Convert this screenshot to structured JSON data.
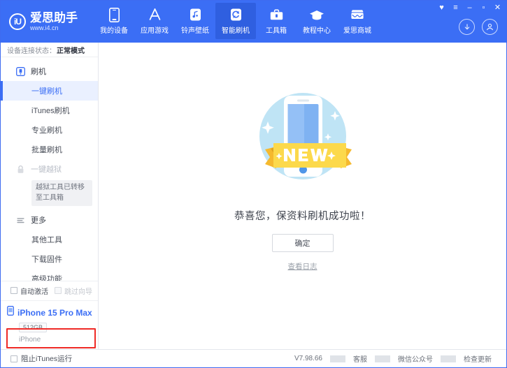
{
  "header": {
    "logo": {
      "badge": "iU",
      "title": "爱思助手",
      "url": "www.i4.cn"
    },
    "nav": [
      {
        "label": "我的设备",
        "icon": "phone-icon",
        "active": false
      },
      {
        "label": "应用游戏",
        "icon": "appstore-icon",
        "active": false
      },
      {
        "label": "铃声壁纸",
        "icon": "music-icon",
        "active": false
      },
      {
        "label": "智能刷机",
        "icon": "refresh-icon",
        "active": true
      },
      {
        "label": "工具箱",
        "icon": "toolbox-icon",
        "active": false
      },
      {
        "label": "教程中心",
        "icon": "graduation-cap-icon",
        "active": false
      },
      {
        "label": "爱思商城",
        "icon": "shop-icon",
        "active": false
      }
    ],
    "window_controls": [
      {
        "name": "skin-icon",
        "glyph": "♥"
      },
      {
        "name": "menu-icon",
        "glyph": "≡"
      },
      {
        "name": "minimize-icon",
        "glyph": "–"
      },
      {
        "name": "maximize-icon",
        "glyph": "▫"
      },
      {
        "name": "close-icon",
        "glyph": "✕"
      }
    ],
    "account_icons": [
      {
        "name": "download-icon"
      },
      {
        "name": "user-account-icon"
      }
    ]
  },
  "sidebar": {
    "connection_label": "设备连接状态：",
    "connection_value": "正常模式",
    "groups": [
      {
        "label": "刷机",
        "icon": "flash-icon",
        "disabled": false
      },
      {
        "label": "一键越狱",
        "icon": "lock-icon",
        "disabled": true
      },
      {
        "label": "更多",
        "icon": "list-icon",
        "disabled": false
      }
    ],
    "items_flash": [
      {
        "label": "一键刷机",
        "active": true
      },
      {
        "label": "iTunes刷机",
        "active": false
      },
      {
        "label": "专业刷机",
        "active": false
      },
      {
        "label": "批量刷机",
        "active": false
      }
    ],
    "jailbreak_note": "越狱工具已转移至工具箱",
    "items_more": [
      {
        "label": "其他工具",
        "active": false
      },
      {
        "label": "下载固件",
        "active": false
      },
      {
        "label": "高级功能",
        "active": false
      }
    ],
    "options": [
      {
        "label": "自动激活",
        "checked": false,
        "disabled": false
      },
      {
        "label": "跳过向导",
        "checked": false,
        "disabled": true
      }
    ],
    "device": {
      "name": "iPhone 15 Pro Max",
      "capacity": "512GB",
      "type": "iPhone"
    }
  },
  "main": {
    "illustration": "new-phone-badge-illustration",
    "illustration_label": "NEW",
    "success_text": "恭喜您，保资料刷机成功啦！",
    "confirm_button": "确定",
    "log_link": "查看日志"
  },
  "statusbar": {
    "block_itunes_label": "阻止iTunes运行",
    "block_itunes_checked": false,
    "version": "V7.98.66",
    "links": [
      "客服",
      "微信公众号",
      "检查更新"
    ]
  },
  "colors": {
    "brand_blue": "#3b6ef5",
    "active_nav_blue": "#2f5fe0",
    "sidebar_active_bg": "#eaf0ff",
    "highlight_red": "#ef2a26",
    "ribbon_yellow": "#fcd94b",
    "circle_blue": "#bfe4f5"
  }
}
